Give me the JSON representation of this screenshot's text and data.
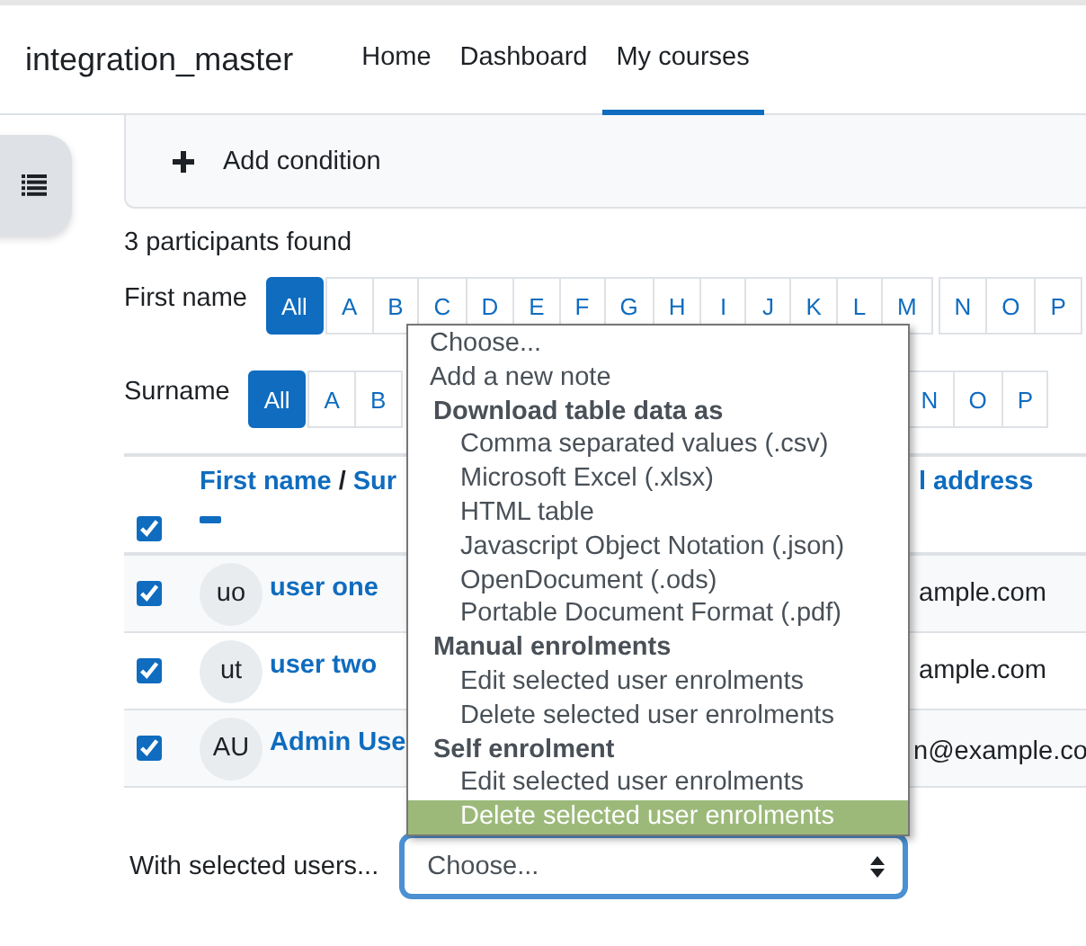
{
  "site": {
    "title": "integration_master"
  },
  "nav": [
    {
      "label": "Home",
      "selected": false
    },
    {
      "label": "Dashboard",
      "selected": false
    },
    {
      "label": "My courses",
      "selected": true
    }
  ],
  "filter": {
    "add_condition": "Add condition"
  },
  "participants_count": "3 participants found",
  "initials_filters": [
    {
      "label": "First name",
      "all": {
        "label": "All",
        "selected": true
      },
      "groups": [
        [
          "A",
          "B",
          "C",
          "D",
          "E",
          "F",
          "G",
          "H",
          "I",
          "J",
          "K",
          "L",
          "M"
        ],
        [
          "N",
          "O",
          "P"
        ]
      ]
    },
    {
      "label": "Surname",
      "all": {
        "label": "All",
        "selected": true
      },
      "groups": [
        [
          "A",
          "B"
        ],
        [
          "N",
          "O",
          "P"
        ]
      ]
    }
  ],
  "table": {
    "select_all_checked": true,
    "column_1": {
      "links": [
        "First name",
        "Sur"
      ],
      "separator": "/"
    },
    "column_2": "l address",
    "rows": [
      {
        "checked": true,
        "initials": "uo",
        "name": "user one",
        "email": "ample.com"
      },
      {
        "checked": true,
        "initials": "ut",
        "name": "user two",
        "email": "ample.com"
      },
      {
        "checked": true,
        "initials": "AU",
        "name": "Admin Use",
        "email": "n@example.co"
      }
    ]
  },
  "bulk_action": {
    "label": "With selected users...",
    "value": "Choose..."
  },
  "dropdown": {
    "items": [
      {
        "kind": "option",
        "label": "Choose...",
        "selected": false
      },
      {
        "kind": "option",
        "label": "Add a new note",
        "selected": false
      },
      {
        "kind": "group",
        "label": "Download table data as"
      },
      {
        "kind": "suboption",
        "label": "Comma separated values (.csv)",
        "selected": false
      },
      {
        "kind": "suboption",
        "label": "Microsoft Excel (.xlsx)",
        "selected": false
      },
      {
        "kind": "suboption",
        "label": "HTML table",
        "selected": false
      },
      {
        "kind": "suboption",
        "label": "Javascript Object Notation (.json)",
        "selected": false
      },
      {
        "kind": "suboption",
        "label": "OpenDocument (.ods)",
        "selected": false
      },
      {
        "kind": "suboption",
        "label": "Portable Document Format (.pdf)",
        "selected": false
      },
      {
        "kind": "group",
        "label": "Manual enrolments"
      },
      {
        "kind": "suboption",
        "label": "Edit selected user enrolments",
        "selected": false
      },
      {
        "kind": "suboption",
        "label": "Delete selected user enrolments",
        "selected": false
      },
      {
        "kind": "group",
        "label": "Self enrolment"
      },
      {
        "kind": "suboption",
        "label": "Edit selected user enrolments",
        "selected": false
      },
      {
        "kind": "suboption",
        "label": "Delete selected user enrolments",
        "selected": true
      }
    ]
  }
}
